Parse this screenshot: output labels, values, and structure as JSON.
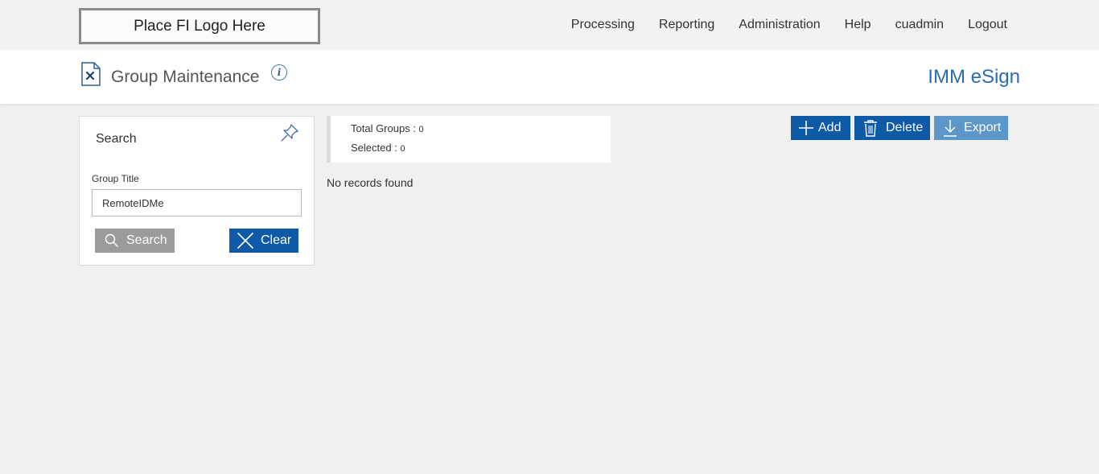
{
  "header": {
    "logo_text": "Place FI Logo Here",
    "nav": [
      "Processing",
      "Reporting",
      "Administration",
      "Help",
      "cuadmin",
      "Logout"
    ]
  },
  "titlebar": {
    "title": "Group Maintenance",
    "info_glyph": "i",
    "brand": "IMM eSign",
    "page_icon": "document-settings-icon"
  },
  "search": {
    "heading": "Search",
    "field_label": "Group Title",
    "field_value": "RemoteIDMe",
    "search_label": "Search",
    "clear_label": "Clear"
  },
  "summary": {
    "total_label": "Total Groups : ",
    "total_value": "0",
    "selected_label": "Selected : ",
    "selected_value": "0",
    "empty_message": "No records found"
  },
  "actions": {
    "add_label": "Add",
    "delete_label": "Delete",
    "export_label": "Export"
  },
  "colors": {
    "primary": "#0e5aa7",
    "export_disabled": "#5d96c9",
    "search_button": "#9b9b9b",
    "brand": "#2b6cb0"
  }
}
